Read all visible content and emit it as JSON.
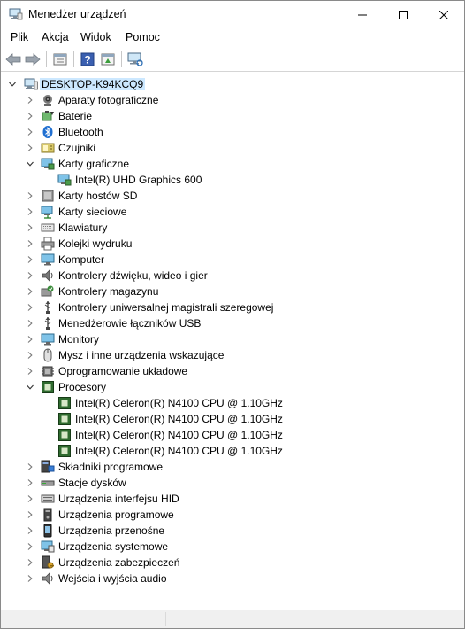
{
  "window": {
    "title": "Menedżer urządzeń",
    "icon": "device-manager-icon"
  },
  "menu": {
    "items": [
      "Plik",
      "Akcja",
      "Widok",
      "Pomoc"
    ]
  },
  "toolbar": {
    "buttons": [
      "back-arrow-icon",
      "forward-arrow-icon",
      "properties-icon",
      "help-icon",
      "update-driver-icon",
      "scan-hardware-icon"
    ]
  },
  "tree": {
    "root": {
      "label": "DESKTOP-K94KCQ9",
      "icon": "computer-icon",
      "expanded": true
    },
    "nodes": [
      {
        "label": "Aparaty fotograficzne",
        "icon": "camera-icon",
        "expanded": false,
        "level": 1
      },
      {
        "label": "Baterie",
        "icon": "battery-icon",
        "expanded": false,
        "level": 1
      },
      {
        "label": "Bluetooth",
        "icon": "bluetooth-icon",
        "expanded": false,
        "level": 1
      },
      {
        "label": "Czujniki",
        "icon": "sensor-icon",
        "expanded": false,
        "level": 1
      },
      {
        "label": "Karty graficzne",
        "icon": "display-adapter-icon",
        "expanded": true,
        "level": 1
      },
      {
        "label": "Intel(R) UHD Graphics 600",
        "icon": "display-adapter-icon",
        "level": 2
      },
      {
        "label": "Karty hostów SD",
        "icon": "sd-host-icon",
        "expanded": false,
        "level": 1
      },
      {
        "label": "Karty sieciowe",
        "icon": "network-adapter-icon",
        "expanded": false,
        "level": 1
      },
      {
        "label": "Klawiatury",
        "icon": "keyboard-icon",
        "expanded": false,
        "level": 1
      },
      {
        "label": "Kolejki wydruku",
        "icon": "printer-icon",
        "expanded": false,
        "level": 1
      },
      {
        "label": "Komputer",
        "icon": "monitor-icon",
        "expanded": false,
        "level": 1
      },
      {
        "label": "Kontrolery dźwięku, wideo i gier",
        "icon": "sound-icon",
        "expanded": false,
        "level": 1
      },
      {
        "label": "Kontrolery magazynu",
        "icon": "storage-controller-icon",
        "expanded": false,
        "level": 1
      },
      {
        "label": "Kontrolery uniwersalnej magistrali szeregowej",
        "icon": "usb-icon",
        "expanded": false,
        "level": 1
      },
      {
        "label": "Menedżerowie łączników USB",
        "icon": "usb-icon",
        "expanded": false,
        "level": 1
      },
      {
        "label": "Monitory",
        "icon": "monitor-icon",
        "expanded": false,
        "level": 1
      },
      {
        "label": "Mysz i inne urządzenia wskazujące",
        "icon": "mouse-icon",
        "expanded": false,
        "level": 1
      },
      {
        "label": "Oprogramowanie układowe",
        "icon": "firmware-icon",
        "expanded": false,
        "level": 1
      },
      {
        "label": "Procesory",
        "icon": "processor-icon",
        "expanded": true,
        "level": 1
      },
      {
        "label": "Intel(R) Celeron(R) N4100 CPU @ 1.10GHz",
        "icon": "processor-icon",
        "level": 2
      },
      {
        "label": "Intel(R) Celeron(R) N4100 CPU @ 1.10GHz",
        "icon": "processor-icon",
        "level": 2
      },
      {
        "label": "Intel(R) Celeron(R) N4100 CPU @ 1.10GHz",
        "icon": "processor-icon",
        "level": 2
      },
      {
        "label": "Intel(R) Celeron(R) N4100 CPU @ 1.10GHz",
        "icon": "processor-icon",
        "level": 2
      },
      {
        "label": "Składniki programowe",
        "icon": "software-component-icon",
        "expanded": false,
        "level": 1
      },
      {
        "label": "Stacje dysków",
        "icon": "disk-drive-icon",
        "expanded": false,
        "level": 1
      },
      {
        "label": "Urządzenia interfejsu HID",
        "icon": "hid-icon",
        "expanded": false,
        "level": 1
      },
      {
        "label": "Urządzenia programowe",
        "icon": "software-device-icon",
        "expanded": false,
        "level": 1
      },
      {
        "label": "Urządzenia przenośne",
        "icon": "portable-device-icon",
        "expanded": false,
        "level": 1
      },
      {
        "label": "Urządzenia systemowe",
        "icon": "system-device-icon",
        "expanded": false,
        "level": 1
      },
      {
        "label": "Urządzenia zabezpieczeń",
        "icon": "security-device-icon",
        "expanded": false,
        "level": 1
      },
      {
        "label": "Wejścia i wyjścia audio",
        "icon": "audio-io-icon",
        "expanded": false,
        "level": 1
      }
    ]
  },
  "colors": {
    "selection": "#cce8ff",
    "accent": "#0078d7"
  }
}
